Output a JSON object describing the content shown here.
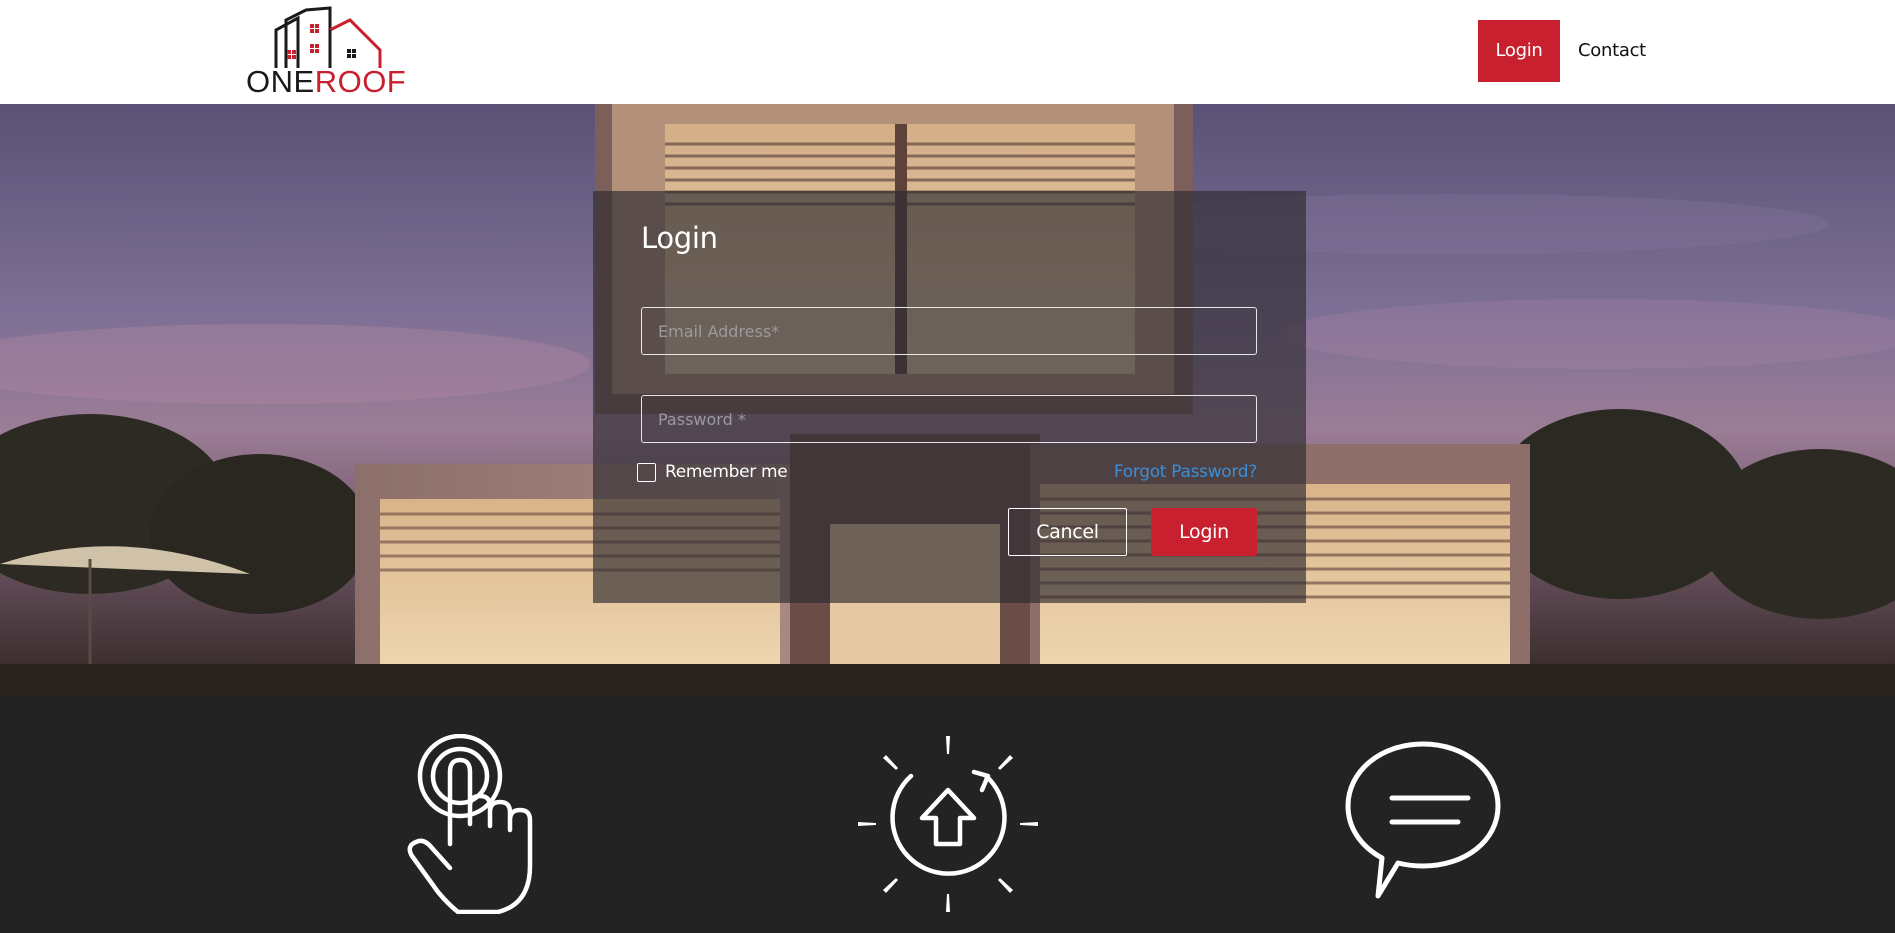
{
  "brand": {
    "name_part1": "ONE",
    "name_part2": "ROOF",
    "primary_color": "#c8202f",
    "dark_color": "#1a1a1a"
  },
  "nav": {
    "login_label": "Login",
    "contact_label": "Contact"
  },
  "login_form": {
    "title": "Login",
    "email_placeholder": "Email Address*",
    "password_placeholder": "Password *",
    "remember_label": "Remember me",
    "forgot_label": "Forgot Password?",
    "cancel_label": "Cancel",
    "submit_label": "Login",
    "link_color": "#3a8ed8"
  },
  "features": {
    "icons": [
      "tap-hand-icon",
      "upload-sunburst-icon",
      "chat-bubble-icon"
    ],
    "background": "#232323"
  },
  "hero": {
    "image": "modern-house-at-dusk"
  }
}
